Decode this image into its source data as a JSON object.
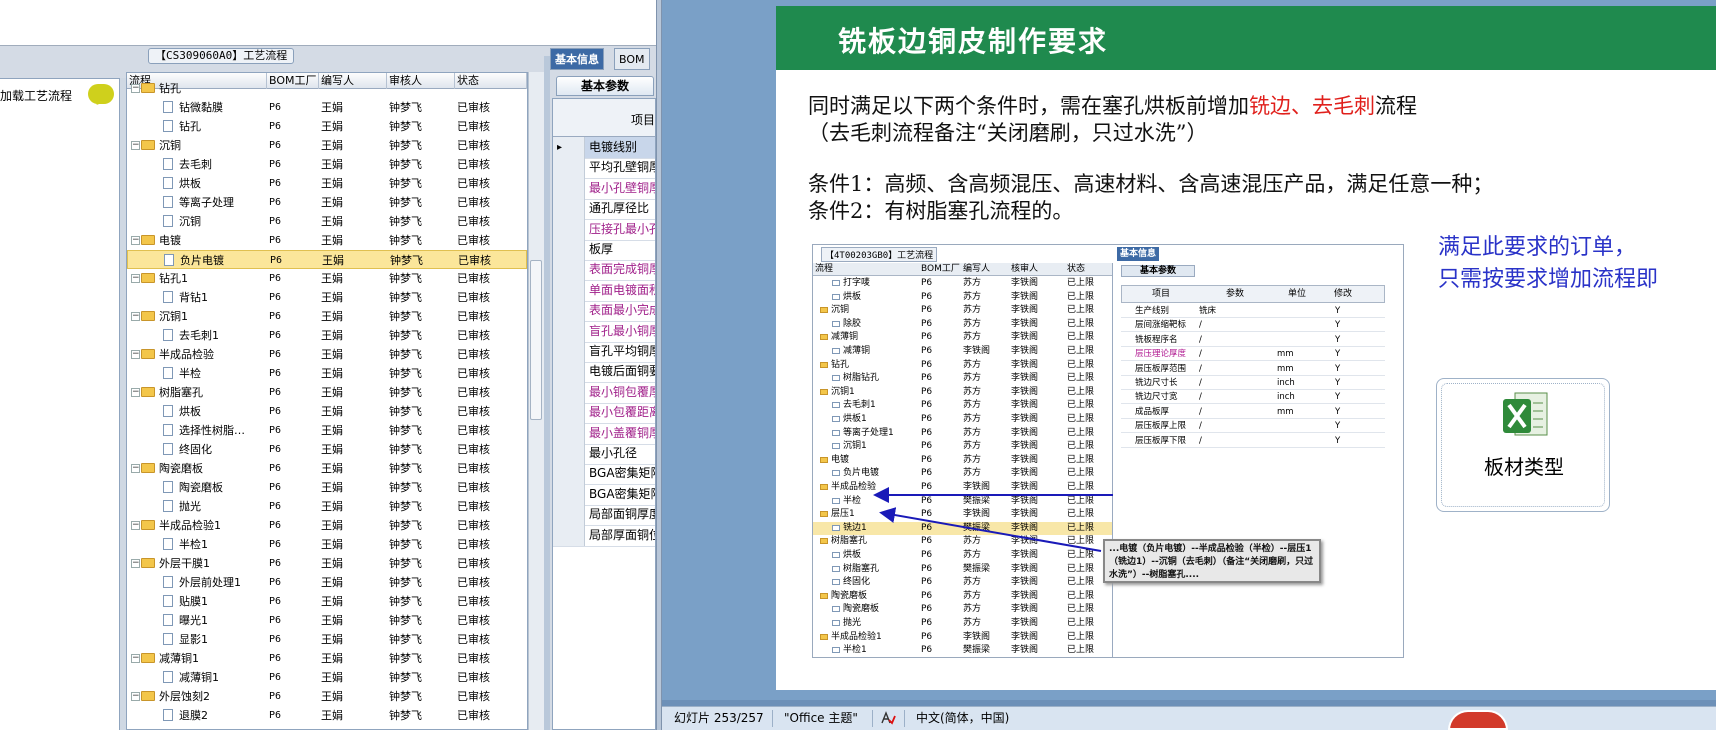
{
  "left_app": {
    "workflow_title": "【CS309060A0】工艺流程",
    "nav_label": "加载工艺流程",
    "tree_headers": [
      "流程",
      "BOM工厂",
      "编写人",
      "审核人",
      "状态"
    ],
    "tree_rows": [
      {
        "name": "钻孔",
        "level": 0,
        "type": "folder",
        "bom": "",
        "writer": "",
        "checker": "",
        "status": ""
      },
      {
        "name": "钻微黏膜",
        "level": 1,
        "type": "doc",
        "bom": "P6",
        "writer": "王娟",
        "checker": "钟梦飞",
        "status": "已审核"
      },
      {
        "name": "钻孔",
        "level": 1,
        "type": "doc",
        "bom": "P6",
        "writer": "王娟",
        "checker": "钟梦飞",
        "status": "已审核"
      },
      {
        "name": "沉铜",
        "level": 0,
        "type": "folder",
        "bom": "P6",
        "writer": "王娟",
        "checker": "钟梦飞",
        "status": "已审核"
      },
      {
        "name": "去毛刺",
        "level": 1,
        "type": "doc",
        "bom": "P6",
        "writer": "王娟",
        "checker": "钟梦飞",
        "status": "已审核"
      },
      {
        "name": "烘板",
        "level": 1,
        "type": "doc",
        "bom": "P6",
        "writer": "王娟",
        "checker": "钟梦飞",
        "status": "已审核"
      },
      {
        "name": "等离子处理",
        "level": 1,
        "type": "doc",
        "bom": "P6",
        "writer": "王娟",
        "checker": "钟梦飞",
        "status": "已审核"
      },
      {
        "name": "沉铜",
        "level": 1,
        "type": "doc",
        "bom": "P6",
        "writer": "王娟",
        "checker": "钟梦飞",
        "status": "已审核"
      },
      {
        "name": "电镀",
        "level": 0,
        "type": "folder",
        "bom": "P6",
        "writer": "王娟",
        "checker": "钟梦飞",
        "status": "已审核"
      },
      {
        "name": "负片电镀",
        "level": 1,
        "type": "doc",
        "bom": "P6",
        "writer": "王娟",
        "checker": "钟梦飞",
        "status": "已审核",
        "selected": true
      },
      {
        "name": "钻孔1",
        "level": 0,
        "type": "folder",
        "bom": "P6",
        "writer": "王娟",
        "checker": "钟梦飞",
        "status": "已审核"
      },
      {
        "name": "背钻1",
        "level": 1,
        "type": "doc",
        "bom": "P6",
        "writer": "王娟",
        "checker": "钟梦飞",
        "status": "已审核"
      },
      {
        "name": "沉铜1",
        "level": 0,
        "type": "folder",
        "bom": "P6",
        "writer": "王娟",
        "checker": "钟梦飞",
        "status": "已审核"
      },
      {
        "name": "去毛刺1",
        "level": 1,
        "type": "doc",
        "bom": "P6",
        "writer": "王娟",
        "checker": "钟梦飞",
        "status": "已审核"
      },
      {
        "name": "半成品检验",
        "level": 0,
        "type": "folder",
        "bom": "P6",
        "writer": "王娟",
        "checker": "钟梦飞",
        "status": "已审核"
      },
      {
        "name": "半检",
        "level": 1,
        "type": "doc",
        "bom": "P6",
        "writer": "王娟",
        "checker": "钟梦飞",
        "status": "已审核"
      },
      {
        "name": "树脂塞孔",
        "level": 0,
        "type": "folder",
        "bom": "P6",
        "writer": "王娟",
        "checker": "钟梦飞",
        "status": "已审核"
      },
      {
        "name": "烘板",
        "level": 1,
        "type": "doc",
        "bom": "P6",
        "writer": "王娟",
        "checker": "钟梦飞",
        "status": "已审核"
      },
      {
        "name": "选择性树脂…",
        "level": 1,
        "type": "doc",
        "bom": "P6",
        "writer": "王娟",
        "checker": "钟梦飞",
        "status": "已审核"
      },
      {
        "name": "终固化",
        "level": 1,
        "type": "doc",
        "bom": "P6",
        "writer": "王娟",
        "checker": "钟梦飞",
        "status": "已审核"
      },
      {
        "name": "陶瓷磨板",
        "level": 0,
        "type": "folder",
        "bom": "P6",
        "writer": "王娟",
        "checker": "钟梦飞",
        "status": "已审核"
      },
      {
        "name": "陶瓷磨板",
        "level": 1,
        "type": "doc",
        "bom": "P6",
        "writer": "王娟",
        "checker": "钟梦飞",
        "status": "已审核"
      },
      {
        "name": "抛光",
        "level": 1,
        "type": "doc",
        "bom": "P6",
        "writer": "王娟",
        "checker": "钟梦飞",
        "status": "已审核"
      },
      {
        "name": "半成品检验1",
        "level": 0,
        "type": "folder",
        "bom": "P6",
        "writer": "王娟",
        "checker": "钟梦飞",
        "status": "已审核"
      },
      {
        "name": "半检1",
        "level": 1,
        "type": "doc",
        "bom": "P6",
        "writer": "王娟",
        "checker": "钟梦飞",
        "status": "已审核"
      },
      {
        "name": "外层干膜1",
        "level": 0,
        "type": "folder",
        "bom": "P6",
        "writer": "王娟",
        "checker": "钟梦飞",
        "status": "已审核"
      },
      {
        "name": "外层前处理1",
        "level": 1,
        "type": "doc",
        "bom": "P6",
        "writer": "王娟",
        "checker": "钟梦飞",
        "status": "已审核"
      },
      {
        "name": "贴膜1",
        "level": 1,
        "type": "doc",
        "bom": "P6",
        "writer": "王娟",
        "checker": "钟梦飞",
        "status": "已审核"
      },
      {
        "name": "曝光1",
        "level": 1,
        "type": "doc",
        "bom": "P6",
        "writer": "王娟",
        "checker": "钟梦飞",
        "status": "已审核"
      },
      {
        "name": "显影1",
        "level": 1,
        "type": "doc",
        "bom": "P6",
        "writer": "王娟",
        "checker": "钟梦飞",
        "status": "已审核"
      },
      {
        "name": "减薄铜1",
        "level": 0,
        "type": "folder",
        "bom": "P6",
        "writer": "王娟",
        "checker": "钟梦飞",
        "status": "已审核"
      },
      {
        "name": "减薄铜1",
        "level": 1,
        "type": "doc",
        "bom": "P6",
        "writer": "王娟",
        "checker": "钟梦飞",
        "status": "已审核"
      },
      {
        "name": "外层蚀刻2",
        "level": 0,
        "type": "folder",
        "bom": "P6",
        "writer": "王娟",
        "checker": "钟梦飞",
        "status": "已审核"
      },
      {
        "name": "退膜2",
        "level": 1,
        "type": "doc",
        "bom": "P6",
        "writer": "王娟",
        "checker": "钟梦飞",
        "status": "已审核"
      }
    ],
    "right_tabs": [
      "基本信息",
      "BOM"
    ],
    "right_subtab": "基本参数",
    "grid_header": "项目",
    "grid_rows": [
      {
        "text": "电镀线别",
        "color": "normal",
        "current": true
      },
      {
        "text": "平均孔壁铜厚",
        "color": "normal"
      },
      {
        "text": "最小孔壁铜厚",
        "color": "pink"
      },
      {
        "text": "通孔厚径比",
        "color": "normal"
      },
      {
        "text": "压接孔最小孔",
        "color": "pink"
      },
      {
        "text": "板厚",
        "color": "normal"
      },
      {
        "text": "表面完成铜厚",
        "color": "pink"
      },
      {
        "text": "单面电镀面积",
        "color": "pink"
      },
      {
        "text": "表面最小完成",
        "color": "pink"
      },
      {
        "text": "盲孔最小铜厚",
        "color": "pink"
      },
      {
        "text": "盲孔平均铜厚",
        "color": "normal"
      },
      {
        "text": "电镀后面铜要",
        "color": "normal"
      },
      {
        "text": "最小铜包覆厚",
        "color": "pink"
      },
      {
        "text": "最小包覆距离",
        "color": "pink"
      },
      {
        "text": "最小盖覆铜厚",
        "color": "pink"
      },
      {
        "text": "最小孔径",
        "color": "normal"
      },
      {
        "text": "BGA密集矩阵",
        "color": "normal"
      },
      {
        "text": "BGA密集矩阵",
        "color": "normal"
      },
      {
        "text": "局部面铜厚度",
        "color": "normal"
      },
      {
        "text": "局部厚面铜位",
        "color": "normal"
      }
    ]
  },
  "slide": {
    "title": "铣板边铜皮制作要求",
    "line1_pre": "同时满足以下两个条件时，需在塞孔烘板前增加",
    "line1_red": "铣边、去毛刺",
    "line1_post": "流程",
    "line2": "（去毛刺流程备注“关闭磨刷，只过水洗”）",
    "cond1": "条件1：高频、含高频混压、高速材料、含高速混压产品，满足任意一种；",
    "cond2": "条件2：有树脂塞孔流程的。",
    "blue_line1": "满足此要求的订单，",
    "blue_line2": "只需按要求增加流程即",
    "excel_label": "板材类型",
    "embedded": {
      "title": "【4T00203GB0】工艺流程",
      "tree_headers": [
        "流程",
        "BOM工厂",
        "编写人",
        "核审人",
        "状态"
      ],
      "rows": [
        {
          "name": "打字唛",
          "lvl": 1,
          "bom": "P6",
          "w": "苏方",
          "c": "李铁阁",
          "s": "已上限"
        },
        {
          "name": "烘板",
          "lvl": 1,
          "bom": "P6",
          "w": "苏方",
          "c": "李铁阁",
          "s": "已上限"
        },
        {
          "name": "沉铜",
          "lvl": 0,
          "bom": "P6",
          "w": "苏方",
          "c": "李铁阁",
          "s": "已上限"
        },
        {
          "name": "除胶",
          "lvl": 1,
          "bom": "P6",
          "w": "苏方",
          "c": "李铁阁",
          "s": "已上限"
        },
        {
          "name": "减薄铜",
          "lvl": 0,
          "bom": "P6",
          "w": "苏方",
          "c": "李铁阁",
          "s": "已上限"
        },
        {
          "name": "减薄铜",
          "lvl": 1,
          "bom": "P6",
          "w": "李铁阁",
          "c": "李铁阁",
          "s": "已上限"
        },
        {
          "name": "钻孔",
          "lvl": 0,
          "bom": "P6",
          "w": "苏方",
          "c": "李铁阁",
          "s": "已上限"
        },
        {
          "name": "树脂钻孔",
          "lvl": 1,
          "bom": "P6",
          "w": "苏方",
          "c": "李铁阁",
          "s": "已上限"
        },
        {
          "name": "沉铜1",
          "lvl": 0,
          "bom": "P6",
          "w": "苏方",
          "c": "李铁阁",
          "s": "已上限"
        },
        {
          "name": "去毛刺1",
          "lvl": 1,
          "bom": "P6",
          "w": "苏方",
          "c": "李铁阁",
          "s": "已上限"
        },
        {
          "name": "烘板1",
          "lvl": 1,
          "bom": "P6",
          "w": "苏方",
          "c": "李铁阁",
          "s": "已上限"
        },
        {
          "name": "等离子处理1",
          "lvl": 1,
          "bom": "P6",
          "w": "苏方",
          "c": "李铁阁",
          "s": "已上限"
        },
        {
          "name": "沉铜1",
          "lvl": 1,
          "bom": "P6",
          "w": "苏方",
          "c": "李铁阁",
          "s": "已上限"
        },
        {
          "name": "电镀",
          "lvl": 0,
          "bom": "P6",
          "w": "苏方",
          "c": "李铁阁",
          "s": "已上限"
        },
        {
          "name": "负片电镀",
          "lvl": 1,
          "bom": "P6",
          "w": "苏方",
          "c": "李铁阁",
          "s": "已上限"
        },
        {
          "name": "半成品检验",
          "lvl": 0,
          "bom": "P6",
          "w": "李铁阁",
          "c": "李铁阁",
          "s": "已上限"
        },
        {
          "name": "半检",
          "lvl": 1,
          "bom": "P6",
          "w": "樊振梁",
          "c": "李铁阁",
          "s": "已上限"
        },
        {
          "name": "层压1",
          "lvl": 0,
          "bom": "P6",
          "w": "李铁阁",
          "c": "李铁阁",
          "s": "已上限"
        },
        {
          "name": "铣边1",
          "lvl": 1,
          "bom": "P6",
          "w": "樊振梁",
          "c": "李铁阁",
          "s": "已上限",
          "sel": true
        },
        {
          "name": "树脂塞孔",
          "lvl": 0,
          "bom": "P6",
          "w": "苏方",
          "c": "李铁阁",
          "s": "已上限"
        },
        {
          "name": "烘板",
          "lvl": 1,
          "bom": "P6",
          "w": "苏方",
          "c": "李铁阁",
          "s": "已上限"
        },
        {
          "name": "树脂塞孔",
          "lvl": 1,
          "bom": "P6",
          "w": "樊振梁",
          "c": "李铁阁",
          "s": "已上限"
        },
        {
          "name": "终固化",
          "lvl": 1,
          "bom": "P6",
          "w": "苏方",
          "c": "李铁阁",
          "s": "已上限"
        },
        {
          "name": "陶瓷磨板",
          "lvl": 0,
          "bom": "P6",
          "w": "苏方",
          "c": "李铁阁",
          "s": "已上限"
        },
        {
          "name": "陶瓷磨板",
          "lvl": 1,
          "bom": "P6",
          "w": "苏方",
          "c": "李铁阁",
          "s": "已上限"
        },
        {
          "name": "抛光",
          "lvl": 1,
          "bom": "P6",
          "w": "苏方",
          "c": "李铁阁",
          "s": "已上限"
        },
        {
          "name": "半成品检验1",
          "lvl": 0,
          "bom": "P6",
          "w": "李铁阁",
          "c": "李铁阁",
          "s": "已上限"
        },
        {
          "name": "半检1",
          "lvl": 1,
          "bom": "P6",
          "w": "樊振梁",
          "c": "李铁阁",
          "s": "已上限"
        }
      ],
      "tab": "基本信息",
      "subtab": "基本参数",
      "grid_headers": [
        "项目",
        "参数",
        "单位",
        "修改"
      ],
      "grid_rows": [
        {
          "item": "生产线别",
          "param": "铣床",
          "unit": "",
          "mod": "Y"
        },
        {
          "item": "层间涨缩靶标",
          "param": "/",
          "unit": "",
          "mod": "Y"
        },
        {
          "item": "铣板程序名",
          "param": "/",
          "unit": "",
          "mod": "Y"
        },
        {
          "item": "层压理论厚度",
          "param": "/",
          "unit": "mm",
          "mod": "Y",
          "pink": true
        },
        {
          "item": "层压板厚范围",
          "param": "/",
          "unit": "mm",
          "mod": "Y"
        },
        {
          "item": "铣边尺寸长",
          "param": "/",
          "unit": "inch",
          "mod": "Y"
        },
        {
          "item": "铣边尺寸宽",
          "param": "/",
          "unit": "inch",
          "mod": "Y"
        },
        {
          "item": "成品板厚",
          "param": "/",
          "unit": "mm",
          "mod": "Y"
        },
        {
          "item": "层压板厚上限",
          "param": "/",
          "unit": "",
          "mod": "Y"
        },
        {
          "item": "层压板厚下限",
          "param": "/",
          "unit": "",
          "mod": "Y"
        }
      ],
      "callout": "...电镀（负片电镀）--半成品检验（半检）--层压1（铣边1）--沉铜（去毛刺）（备注“关闭磨刷，只过水洗”）--树脂塞孔...."
    }
  },
  "statusbar": {
    "slide_counter": "幻灯片 253/257",
    "theme": "\"Office 主题\"",
    "language": "中文(简体，中国)"
  },
  "colors": {
    "slide_header": "#1f8a4e",
    "highlight_red": "#e0201c",
    "blue_note": "#2a33c8",
    "pink_item": "#a0208a"
  }
}
